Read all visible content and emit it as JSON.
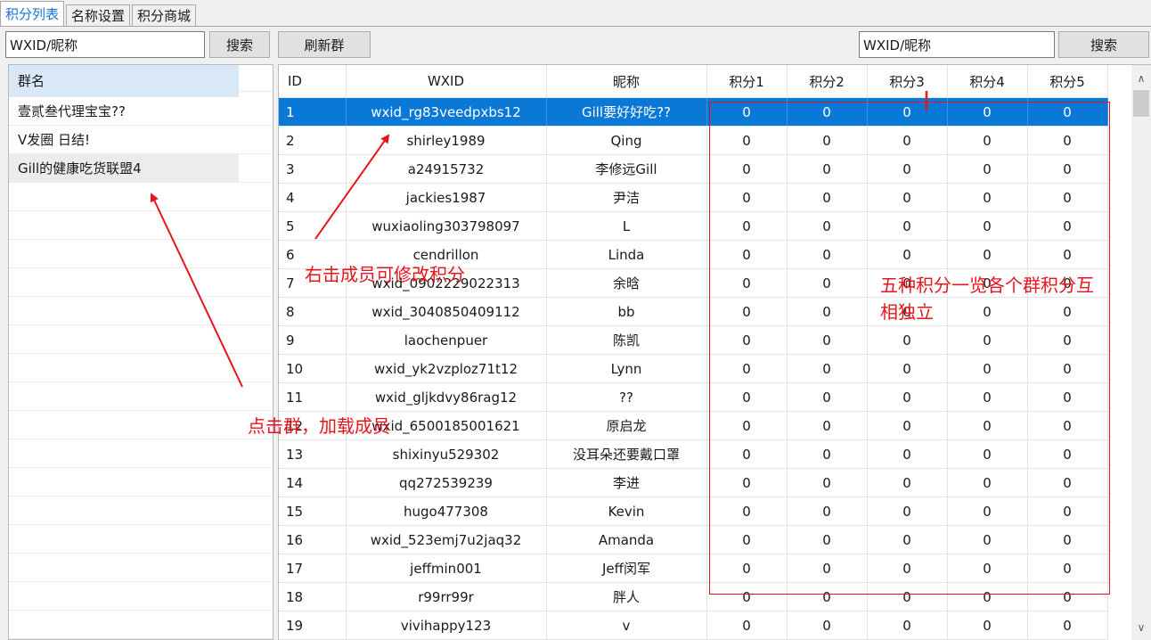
{
  "tabs": [
    {
      "label": "积分列表",
      "active": true
    },
    {
      "label": "名称设置",
      "active": false
    },
    {
      "label": "积分商城",
      "active": false
    }
  ],
  "left_toolbar": {
    "search_value": "WXID/昵称",
    "search_button": "搜索"
  },
  "right_toolbar": {
    "refresh_button": "刷新群",
    "search_value": "WXID/昵称",
    "search_button": "搜索"
  },
  "groups": {
    "header": "群名",
    "items": [
      "壹贰叁代理宝宝??",
      "V发圈 日结!",
      "Gill的健康吃货联盟4"
    ],
    "selected_index": 2
  },
  "members": {
    "columns": [
      "ID",
      "WXID",
      "昵称",
      "积分1",
      "积分2",
      "积分3",
      "积分4",
      "积分5"
    ],
    "selected_index": 0,
    "rows": [
      [
        "1",
        "wxid_rg83veedpxbs12",
        "Gill要好好吃??",
        "0",
        "0",
        "0",
        "0",
        "0"
      ],
      [
        "2",
        "shirley1989",
        "Qing",
        "0",
        "0",
        "0",
        "0",
        "0"
      ],
      [
        "3",
        "a24915732",
        "李修远Gill",
        "0",
        "0",
        "0",
        "0",
        "0"
      ],
      [
        "4",
        "jackies1987",
        "尹洁",
        "0",
        "0",
        "0",
        "0",
        "0"
      ],
      [
        "5",
        "wuxiaoling303798097",
        "L",
        "0",
        "0",
        "0",
        "0",
        "0"
      ],
      [
        "6",
        "cendrillon",
        "Linda",
        "0",
        "0",
        "0",
        "0",
        "0"
      ],
      [
        "7",
        "wxid_0902229022313",
        "余晗",
        "0",
        "0",
        "0",
        "0",
        "0"
      ],
      [
        "8",
        "wxid_3040850409112",
        "bb",
        "0",
        "0",
        "0",
        "0",
        "0"
      ],
      [
        "9",
        "laochenpuer",
        "陈凯",
        "0",
        "0",
        "0",
        "0",
        "0"
      ],
      [
        "10",
        "wxid_yk2vzploz71t12",
        "Lynn",
        "0",
        "0",
        "0",
        "0",
        "0"
      ],
      [
        "11",
        "wxid_gljkdvy86rag12",
        "??",
        "0",
        "0",
        "0",
        "0",
        "0"
      ],
      [
        "12",
        "wxid_6500185001621",
        "原启龙",
        "0",
        "0",
        "0",
        "0",
        "0"
      ],
      [
        "13",
        "shixinyu529302",
        "没耳朵还要戴口罩",
        "0",
        "0",
        "0",
        "0",
        "0"
      ],
      [
        "14",
        "qq272539239",
        "李进",
        "0",
        "0",
        "0",
        "0",
        "0"
      ],
      [
        "15",
        "hugo477308",
        "Kevin",
        "0",
        "0",
        "0",
        "0",
        "0"
      ],
      [
        "16",
        "wxid_523emj7u2jaq32",
        "Amanda",
        "0",
        "0",
        "0",
        "0",
        "0"
      ],
      [
        "17",
        "jeffmin001",
        "Jeff闵军",
        "0",
        "0",
        "0",
        "0",
        "0"
      ],
      [
        "18",
        "r99rr99r",
        "胖人",
        "0",
        "0",
        "0",
        "0",
        "0"
      ],
      [
        "19",
        "vivihappy123",
        "v",
        "0",
        "0",
        "0",
        "0",
        "0"
      ]
    ]
  },
  "annotations": {
    "right_click": "右击成员可修改积分",
    "five_points_line1": "五种积分一览各个群积分互",
    "five_points_line2": "相独立",
    "click_group": "点击群，加载成员"
  },
  "colors": {
    "accent": "#0a78d7",
    "annotation": "#e8141c",
    "tab_active": "#1e6fd9"
  }
}
